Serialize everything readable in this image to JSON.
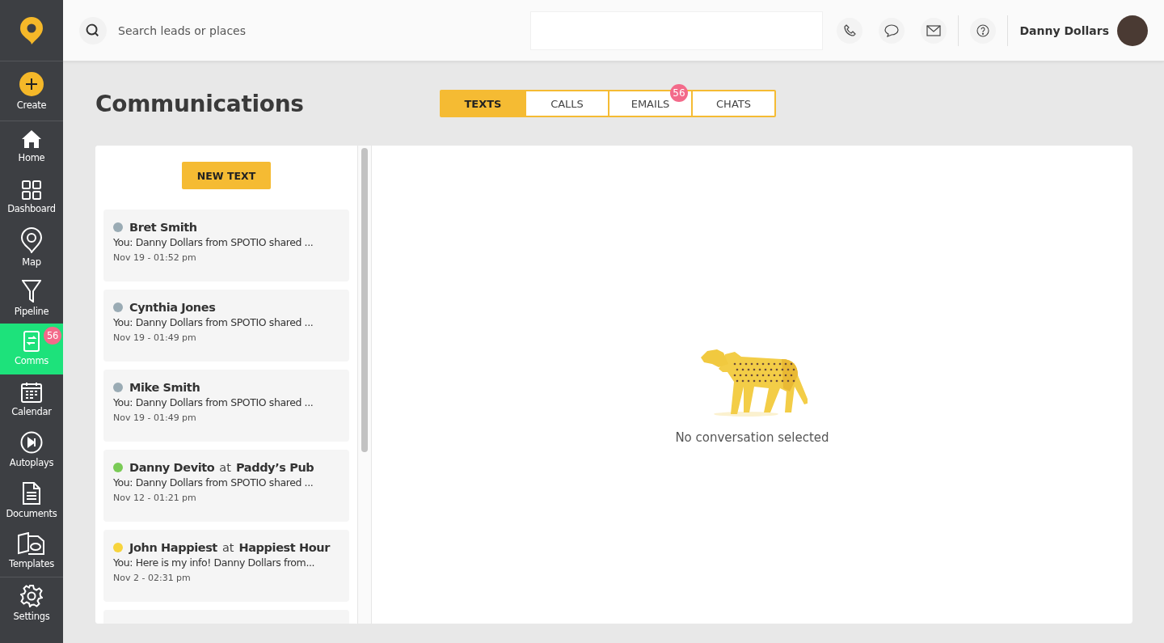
{
  "sidebar": {
    "items": [
      {
        "kind": "create",
        "label": "Create",
        "selected": false
      },
      {
        "kind": "home",
        "label": "Home",
        "selected": false
      },
      {
        "kind": "dashboard",
        "label": "Dashboard",
        "selected": false
      },
      {
        "kind": "map",
        "label": "Map",
        "selected": false
      },
      {
        "kind": "pipeline",
        "label": "Pipeline",
        "selected": false
      },
      {
        "kind": "comms",
        "label": "Comms",
        "selected": true,
        "badge": "56"
      },
      {
        "kind": "calendar",
        "label": "Calendar",
        "selected": false
      },
      {
        "kind": "autoplays",
        "label": "Autoplays",
        "selected": false
      },
      {
        "kind": "documents",
        "label": "Documents",
        "selected": false
      },
      {
        "kind": "templates",
        "label": "Templates",
        "selected": false
      },
      {
        "kind": "settings",
        "label": "Settings",
        "selected": false
      }
    ]
  },
  "header": {
    "search": {
      "placeholder": "Search leads or places"
    },
    "user_name": "Danny Dollars"
  },
  "page_title": "Communications",
  "tabs": [
    {
      "label": "TEXTS",
      "selected": true
    },
    {
      "label": "CALLS",
      "selected": false
    },
    {
      "label": "EMAILS",
      "selected": false,
      "badge": "56"
    },
    {
      "label": "CHATS",
      "selected": false
    }
  ],
  "new_text_button": "NEW TEXT",
  "conversations": [
    {
      "name": "Bret Smith",
      "preview": "You: Danny Dollars from SPOTIO shared ...",
      "time": "Nov 19 - 01:52 pm",
      "color": "#9aabb4"
    },
    {
      "name": "Cynthia Jones",
      "preview": "You: Danny Dollars from SPOTIO shared ...",
      "time": "Nov 19 - 01:49 pm",
      "color": "#9aabb4"
    },
    {
      "name": "Mike Smith",
      "preview": "You: Danny Dollars from SPOTIO shared ...",
      "time": "Nov 19 - 01:49 pm",
      "color": "#9aabb4"
    },
    {
      "name": "Danny Devito",
      "at": "at",
      "place": "Paddy’s Pub",
      "preview": "You: Danny Dollars from SPOTIO shared ...",
      "time": "Nov 12 - 01:21 pm",
      "color": "#7acb56"
    },
    {
      "name": "John Happiest",
      "at": "at",
      "place": "Happiest Hour",
      "preview": "You: Here is my info! Danny Dollars from...",
      "time": "Nov 2 - 02:31 pm",
      "color": "#f7d43c"
    }
  ],
  "empty_state": "No conversation selected"
}
